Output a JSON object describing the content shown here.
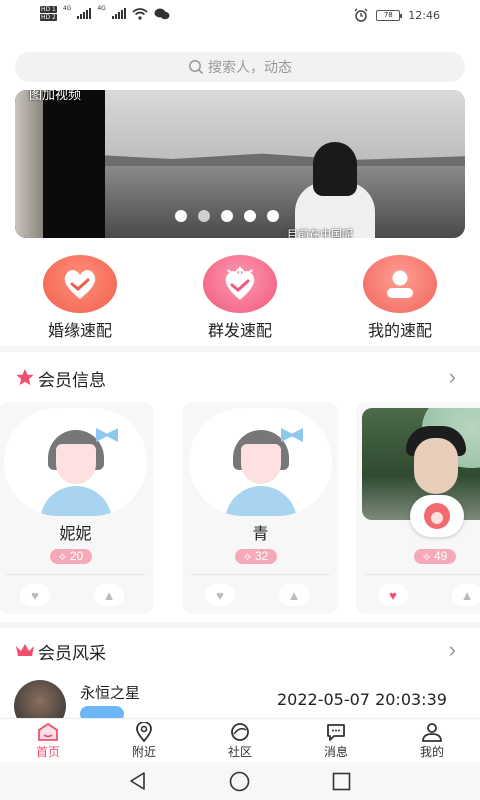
{
  "status_bar": {
    "network_labels": [
      "HD 1",
      "HD 2"
    ],
    "signal_1": "4G",
    "signal_2": "4G",
    "battery": "78",
    "time": "12:46"
  },
  "search": {
    "placeholder": "搜索人，动态",
    "icon": "search-icon"
  },
  "banner": {
    "top_caption": "图加视频",
    "bottom_caption": "目前在中国呢",
    "dots_count": 5
  },
  "quick_actions": [
    {
      "label": "婚缘速配",
      "icon": "handshake-heart-icon",
      "color": "#f0604f"
    },
    {
      "label": "群发速配",
      "icon": "handshake-arrows-icon",
      "color": "#f1587e"
    },
    {
      "label": "我的速配",
      "icon": "user-icon",
      "color": "#f0665c"
    }
  ],
  "member_section": {
    "title": "会员信息",
    "icon": "star-icon",
    "more": "chevron-right-icon"
  },
  "members": [
    {
      "name": "妮妮",
      "count": "20",
      "liked": false
    },
    {
      "name": "青",
      "count": "32",
      "liked": false
    },
    {
      "name": "",
      "count": "49",
      "liked": true
    }
  ],
  "style_section": {
    "title": "会员风采",
    "icon": "crown-icon",
    "more": "chevron-right-icon"
  },
  "feed": {
    "name": "永恒之星",
    "time": "2022-05-07 20:03:39"
  },
  "tabs": [
    {
      "label": "首页",
      "icon": "home-icon",
      "active": true
    },
    {
      "label": "附近",
      "icon": "location-icon",
      "active": false
    },
    {
      "label": "社区",
      "icon": "community-icon",
      "active": false
    },
    {
      "label": "消息",
      "icon": "message-icon",
      "active": false
    },
    {
      "label": "我的",
      "icon": "profile-icon",
      "active": false
    }
  ],
  "colors": {
    "accent": "#f0506e",
    "badge": "#f6a9b8",
    "search_bg": "#f2f2f2"
  }
}
